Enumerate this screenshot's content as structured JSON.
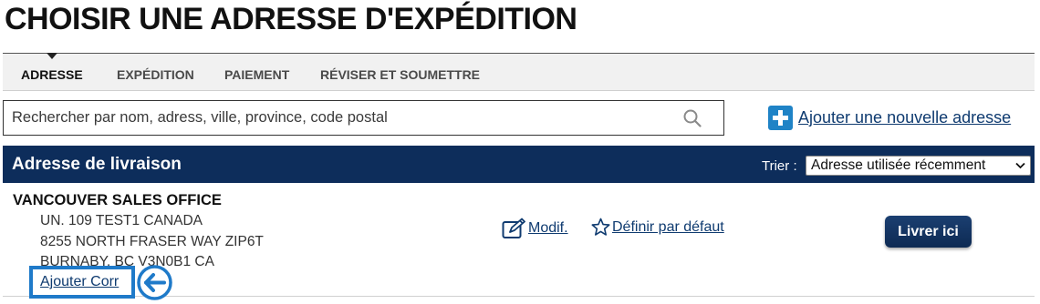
{
  "page": {
    "title": "CHOISIR UNE ADRESSE D'EXPÉDITION"
  },
  "steps": [
    {
      "label": "ADRESSE",
      "active": true
    },
    {
      "label": "EXPÉDITION",
      "active": false
    },
    {
      "label": "PAIEMENT",
      "active": false
    },
    {
      "label": "RÉVISER ET SOUMETTRE",
      "active": false
    }
  ],
  "search": {
    "placeholder": "Rechercher par nom, adress, ville, province, code postal",
    "value": "",
    "icon": "search-icon"
  },
  "add_address": {
    "label": "Ajouter une nouvelle adresse",
    "icon": "plus-icon"
  },
  "address_list": {
    "header": "Adresse de livraison",
    "sort_label": "Trier :",
    "sort_selected": "Adresse utilisée récemment"
  },
  "address": {
    "name": "VANCOUVER SALES OFFICE",
    "lines": [
      "UN. 109 TEST1 CANADA",
      "8255 NORTH FRASER WAY ZIP6T",
      "BURNABY, BC V3N0B1 CA"
    ],
    "edit_label": "Modif.",
    "default_label": "Définir par défaut",
    "ship_button": "Livrer ici",
    "add_corr_label": "Ajouter Corr"
  },
  "colors": {
    "header_bg": "#0d2d5b",
    "link": "#0f3b70",
    "accent_blue": "#1f83c6",
    "highlight_border": "#1f7ac9"
  }
}
